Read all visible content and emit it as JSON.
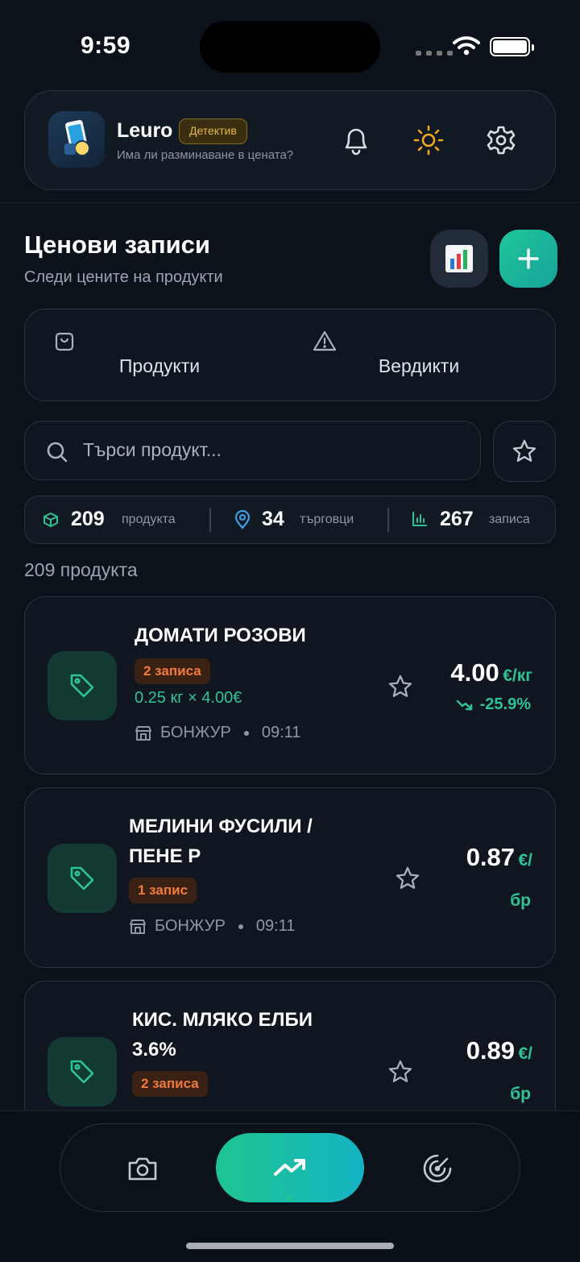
{
  "status_bar": {
    "time": "9:59"
  },
  "header": {
    "app_name": "Leuro",
    "badge": "Детектив",
    "subtitle": "Има ли разминаване в цената?"
  },
  "page": {
    "title": "Ценови записи",
    "subtitle": "Следи цените на продукти"
  },
  "tabs": [
    {
      "label": "Продукти",
      "icon": "shopping-bag-icon"
    },
    {
      "label": "Вердикти",
      "icon": "warning-triangle-icon"
    }
  ],
  "search": {
    "placeholder": "Търси продукт..."
  },
  "stats": [
    {
      "value": "209",
      "label": "продукта",
      "icon": "box-icon"
    },
    {
      "value": "34",
      "label": "търговци",
      "icon": "map-pin-icon"
    },
    {
      "value": "267",
      "label": "записа",
      "icon": "bar-chart-icon"
    }
  ],
  "count_label": "209 продукта",
  "products": [
    {
      "name_lines": [
        "ДОМАТИ РОЗОВИ"
      ],
      "badge": "2 записа",
      "calc": "0.25 кг × 4.00€",
      "store": "БОНЖУР",
      "time": "09:11",
      "price": "4.00",
      "unit": "€/кг",
      "change": "-25.9%"
    },
    {
      "name_lines": [
        "МЕЛИНИ ФУСИЛИ /",
        "ПЕНЕ Р"
      ],
      "badge": "1 запис",
      "store": "БОНЖУР",
      "time": "09:11",
      "price": "0.87",
      "unit_line1": "€/",
      "unit_line2": "бр"
    },
    {
      "name_lines": [
        "КИС. МЛЯКО ЕЛБИ",
        "3.6%"
      ],
      "badge": "2 записа",
      "price": "0.89",
      "unit_line1": "€/",
      "unit_line2": "бр"
    }
  ],
  "nav": [
    {
      "icon": "camera-icon"
    },
    {
      "icon": "trending-up-icon",
      "active": true
    },
    {
      "icon": "radar-icon"
    }
  ],
  "colors": {
    "accent": "#1fc58f",
    "warning_badge": "#f07b3a",
    "detective_badge": "#e6b94a"
  }
}
